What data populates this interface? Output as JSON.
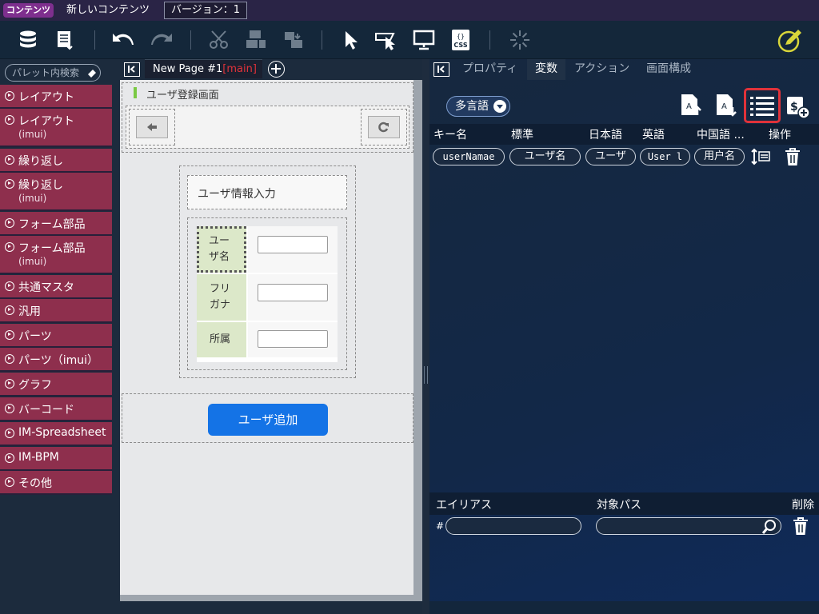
{
  "topbar": {
    "badge": "コンテンツ",
    "title": "新しいコンテンツ",
    "version": "バージョン：1"
  },
  "palette": {
    "search_placeholder": "パレット内検索",
    "items": [
      {
        "label": "レイアウト",
        "sub": ""
      },
      {
        "label": "レイアウト",
        "sub": "(imui)"
      },
      {
        "label": "繰り返し",
        "sub": ""
      },
      {
        "label": "繰り返し",
        "sub": "(imui)"
      },
      {
        "label": "フォーム部品",
        "sub": ""
      },
      {
        "label": "フォーム部品",
        "sub": "(imui)"
      },
      {
        "label": "共通マスタ",
        "sub": ""
      },
      {
        "label": "汎用",
        "sub": ""
      },
      {
        "label": "パーツ",
        "sub": ""
      },
      {
        "label": "パーツ（imui）",
        "sub": ""
      },
      {
        "label": "グラフ",
        "sub": ""
      },
      {
        "label": "バーコード",
        "sub": ""
      },
      {
        "label": "IM-Spreadsheet",
        "sub": ""
      },
      {
        "label": "IM-BPM",
        "sub": ""
      },
      {
        "label": "その他",
        "sub": ""
      }
    ]
  },
  "canvas": {
    "tab_name": "New Page #1",
    "tab_branch": "[main]",
    "screen_title": "ユーザ登録画面",
    "section_title": "ユーザ情報入力",
    "fields": [
      {
        "label": "ユー\nザ名"
      },
      {
        "label": "フリ\nガナ"
      },
      {
        "label": "所属"
      }
    ],
    "submit_label": "ユーザ追加"
  },
  "right": {
    "tabs": [
      "プロパティ",
      "変数",
      "アクション",
      "画面構成"
    ],
    "active_tab": "変数",
    "lang_button": "多言語",
    "columns": [
      "キー名",
      "標準",
      "日本語",
      "英語",
      "中国語 ...",
      "操作"
    ],
    "row": {
      "key": "userNamae",
      "standard": "ユーザ名",
      "ja": "ユーザ",
      "en": "User l",
      "zh": "用户名"
    },
    "alias": {
      "header_alias": "エイリアス",
      "header_path": "対象パス",
      "header_delete": "削除",
      "hash": "#"
    }
  },
  "colors": {
    "accent": "#e0323a",
    "palette_item": "#8e2f4d",
    "primary_button": "#1473e6"
  }
}
